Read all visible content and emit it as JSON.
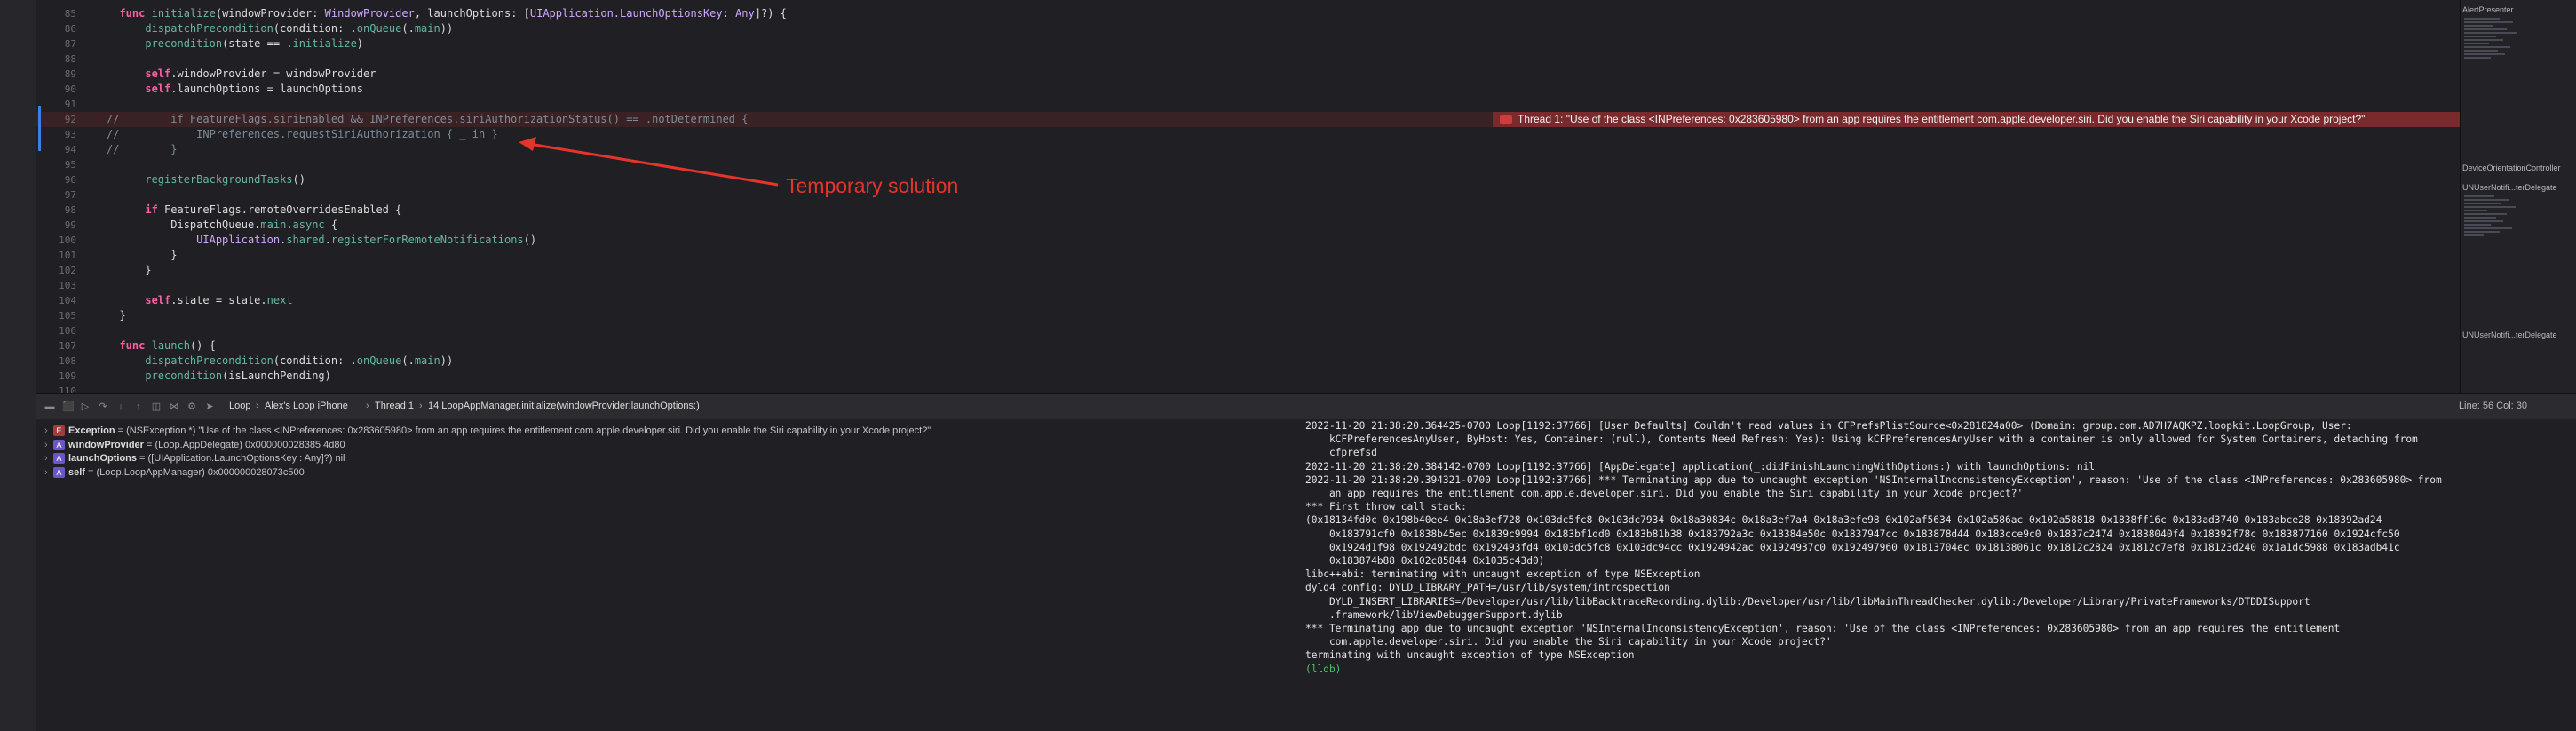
{
  "editor": {
    "lines": [
      {
        "num": "85",
        "parts": [
          [
            "  ",
            ""
          ],
          [
            "func",
            "kw"
          ],
          [
            " ",
            ""
          ],
          [
            "initialize",
            "fn"
          ],
          [
            "(windowProvider: ",
            ""
          ],
          [
            "WindowProvider",
            "ty"
          ],
          [
            ", launchOptions: [",
            ""
          ],
          [
            "UIApplication.LaunchOptionsKey",
            "ty"
          ],
          [
            ": ",
            ""
          ],
          [
            "Any",
            "ty"
          ],
          [
            "]?) {",
            ""
          ]
        ]
      },
      {
        "num": "86",
        "parts": [
          [
            "      ",
            ""
          ],
          [
            "dispatchPrecondition",
            "fn"
          ],
          [
            "(condition: .",
            ""
          ],
          [
            "onQueue",
            "fn"
          ],
          [
            "(.",
            ""
          ],
          [
            "main",
            "fn"
          ],
          [
            "))",
            ""
          ]
        ]
      },
      {
        "num": "87",
        "parts": [
          [
            "      ",
            ""
          ],
          [
            "precondition",
            "fn"
          ],
          [
            "(state == .",
            ""
          ],
          [
            "initialize",
            "fn"
          ],
          [
            ")",
            ""
          ]
        ]
      },
      {
        "num": "88",
        "parts": [
          [
            "",
            ""
          ]
        ]
      },
      {
        "num": "89",
        "parts": [
          [
            "      ",
            ""
          ],
          [
            "self",
            "kw"
          ],
          [
            ".windowProvider = windowProvider",
            ""
          ]
        ]
      },
      {
        "num": "90",
        "parts": [
          [
            "      ",
            ""
          ],
          [
            "self",
            "kw"
          ],
          [
            ".launchOptions = launchOptions",
            ""
          ]
        ]
      },
      {
        "num": "91",
        "parts": [
          [
            "",
            ""
          ]
        ]
      },
      {
        "num": "92",
        "error": true,
        "parts": [
          [
            "//        if FeatureFlags.siriEnabled && INPreferences.siriAuthorizationStatus() == .notDetermined {",
            "cm"
          ]
        ]
      },
      {
        "num": "93",
        "parts": [
          [
            "//            INPreferences.requestSiriAuthorization { _ in }",
            "cm"
          ]
        ]
      },
      {
        "num": "94",
        "parts": [
          [
            "//        }",
            "cm"
          ]
        ]
      },
      {
        "num": "95",
        "parts": [
          [
            "",
            ""
          ]
        ]
      },
      {
        "num": "96",
        "parts": [
          [
            "      ",
            ""
          ],
          [
            "registerBackgroundTasks",
            "fn"
          ],
          [
            "()",
            ""
          ]
        ]
      },
      {
        "num": "97",
        "parts": [
          [
            "",
            ""
          ]
        ]
      },
      {
        "num": "98",
        "parts": [
          [
            "      ",
            ""
          ],
          [
            "if",
            "kw"
          ],
          [
            " FeatureFlags.remoteOverridesEnabled {",
            ""
          ]
        ]
      },
      {
        "num": "99",
        "parts": [
          [
            "          DispatchQueue.",
            ""
          ],
          [
            "main",
            "fn"
          ],
          [
            ".",
            ""
          ],
          [
            "async",
            "fn"
          ],
          [
            " {",
            ""
          ]
        ]
      },
      {
        "num": "100",
        "parts": [
          [
            "              ",
            ""
          ],
          [
            "UIApplication",
            "ty"
          ],
          [
            ".",
            ""
          ],
          [
            "shared",
            "fn"
          ],
          [
            ".",
            ""
          ],
          [
            "registerForRemoteNotifications",
            "fn"
          ],
          [
            "()",
            ""
          ]
        ]
      },
      {
        "num": "101",
        "parts": [
          [
            "          }",
            ""
          ]
        ]
      },
      {
        "num": "102",
        "parts": [
          [
            "      }",
            ""
          ]
        ]
      },
      {
        "num": "103",
        "parts": [
          [
            "",
            ""
          ]
        ]
      },
      {
        "num": "104",
        "parts": [
          [
            "      ",
            ""
          ],
          [
            "self",
            "kw"
          ],
          [
            ".state = state.",
            ""
          ],
          [
            "next",
            "fn"
          ]
        ]
      },
      {
        "num": "105",
        "parts": [
          [
            "  }",
            ""
          ]
        ]
      },
      {
        "num": "106",
        "parts": [
          [
            "",
            ""
          ]
        ]
      },
      {
        "num": "107",
        "parts": [
          [
            "  ",
            ""
          ],
          [
            "func",
            "kw"
          ],
          [
            " ",
            ""
          ],
          [
            "launch",
            "fn"
          ],
          [
            "() {",
            ""
          ]
        ]
      },
      {
        "num": "108",
        "parts": [
          [
            "      ",
            ""
          ],
          [
            "dispatchPrecondition",
            "fn"
          ],
          [
            "(condition: .",
            ""
          ],
          [
            "onQueue",
            "fn"
          ],
          [
            "(.",
            ""
          ],
          [
            "main",
            "fn"
          ],
          [
            "))",
            ""
          ]
        ]
      },
      {
        "num": "109",
        "parts": [
          [
            "      ",
            ""
          ],
          [
            "precondition",
            "fn"
          ],
          [
            "(isLaunchPending)",
            ""
          ]
        ]
      },
      {
        "num": "110",
        "parts": [
          [
            "",
            ""
          ]
        ]
      }
    ],
    "error_message": "Thread 1: \"Use of the class <INPreferences: 0x283605980> from an app requires the entitlement com.apple.developer.siri. Did you enable the Siri capability in your Xcode project?\"",
    "annotation": "Temporary solution",
    "annotation_color": "#e5352b"
  },
  "minimap": {
    "sections": [
      "AlertPresenter",
      "DeviceOrientationController",
      "UNUserNotifi...terDelegate",
      "UNUserNotifi...terDelegate"
    ]
  },
  "debug_bar": {
    "breadcrumb": [
      "Loop",
      "Alex's Loop iPhone",
      "Thread 1",
      "14 LoopAppManager.initialize(windowProvider:launchOptions:)"
    ],
    "cursor_position": "Line: 56  Col: 30"
  },
  "variables": [
    {
      "badge": "E",
      "name": "Exception",
      "value": " = (NSException *) \"Use of the class <INPreferences: 0x283605980> from an app requires the entitlement com.apple.developer.siri. Did you enable the Siri capability in your Xcode project?\""
    },
    {
      "badge": "A",
      "name": "windowProvider",
      "value": " = (Loop.AppDelegate) 0x000000028385 4d80"
    },
    {
      "badge": "A",
      "name": "launchOptions",
      "value": " = ([UIApplication.LaunchOptionsKey : Any]?) nil"
    },
    {
      "badge": "A",
      "name": "self",
      "value": " = (Loop.LoopAppManager) 0x000000028073c500"
    }
  ],
  "console": {
    "lines": [
      "2022-11-20 21:38:20.364425-0700 Loop[1192:37766] [User Defaults] Couldn't read values in CFPrefsPlistSource<0x281824a00> (Domain: group.com.AD7H7AQKPZ.loopkit.LoopGroup, User:",
      "    kCFPreferencesAnyUser, ByHost: Yes, Container: (null), Contents Need Refresh: Yes): Using kCFPreferencesAnyUser with a container is only allowed for System Containers, detaching from",
      "    cfprefsd",
      "2022-11-20 21:38:20.384142-0700 Loop[1192:37766] [AppDelegate] application(_:didFinishLaunchingWithOptions:) with launchOptions: nil",
      "2022-11-20 21:38:20.394321-0700 Loop[1192:37766] *** Terminating app due to uncaught exception 'NSInternalInconsistencyException', reason: 'Use of the class <INPreferences: 0x283605980> from",
      "    an app requires the entitlement com.apple.developer.siri. Did you enable the Siri capability in your Xcode project?'",
      "*** First throw call stack:",
      "(0x18134fd0c 0x198b40ee4 0x18a3ef728 0x103dc5fc8 0x103dc7934 0x18a30834c 0x18a3ef7a4 0x18a3efe98 0x102af5634 0x102a586ac 0x102a58818 0x1838ff16c 0x183ad3740 0x183abce28 0x18392ad24",
      "    0x183791cf0 0x1838b45ec 0x1839c9994 0x183bf1dd0 0x183b81b38 0x183792a3c 0x18384e50c 0x1837947cc 0x183878d44 0x183cce9c0 0x1837c2474 0x1838040f4 0x18392f78c 0x183877160 0x1924cfc50",
      "    0x1924d1f98 0x192492bdc 0x192493fd4 0x103dc5fc8 0x103dc94cc 0x1924942ac 0x1924937c0 0x192497960 0x1813704ec 0x18138061c 0x1812c2824 0x1812c7ef8 0x18123d240 0x1a1dc5988 0x183adb41c",
      "    0x183874b88 0x102c85844 0x1035c43d0)",
      "libc++abi: terminating with uncaught exception of type NSException",
      "dyld4 config: DYLD_LIBRARY_PATH=/usr/lib/system/introspection",
      "    DYLD_INSERT_LIBRARIES=/Developer/usr/lib/libBacktraceRecording.dylib:/Developer/usr/lib/libMainThreadChecker.dylib:/Developer/Library/PrivateFrameworks/DTDDISupport",
      "    .framework/libViewDebuggerSupport.dylib",
      "*** Terminating app due to uncaught exception 'NSInternalInconsistencyException', reason: 'Use of the class <INPreferences: 0x283605980> from an app requires the entitlement",
      "    com.apple.developer.siri. Did you enable the Siri capability in your Xcode project?'",
      "terminating with uncaught exception of type NSException",
      "(lldb)"
    ]
  }
}
